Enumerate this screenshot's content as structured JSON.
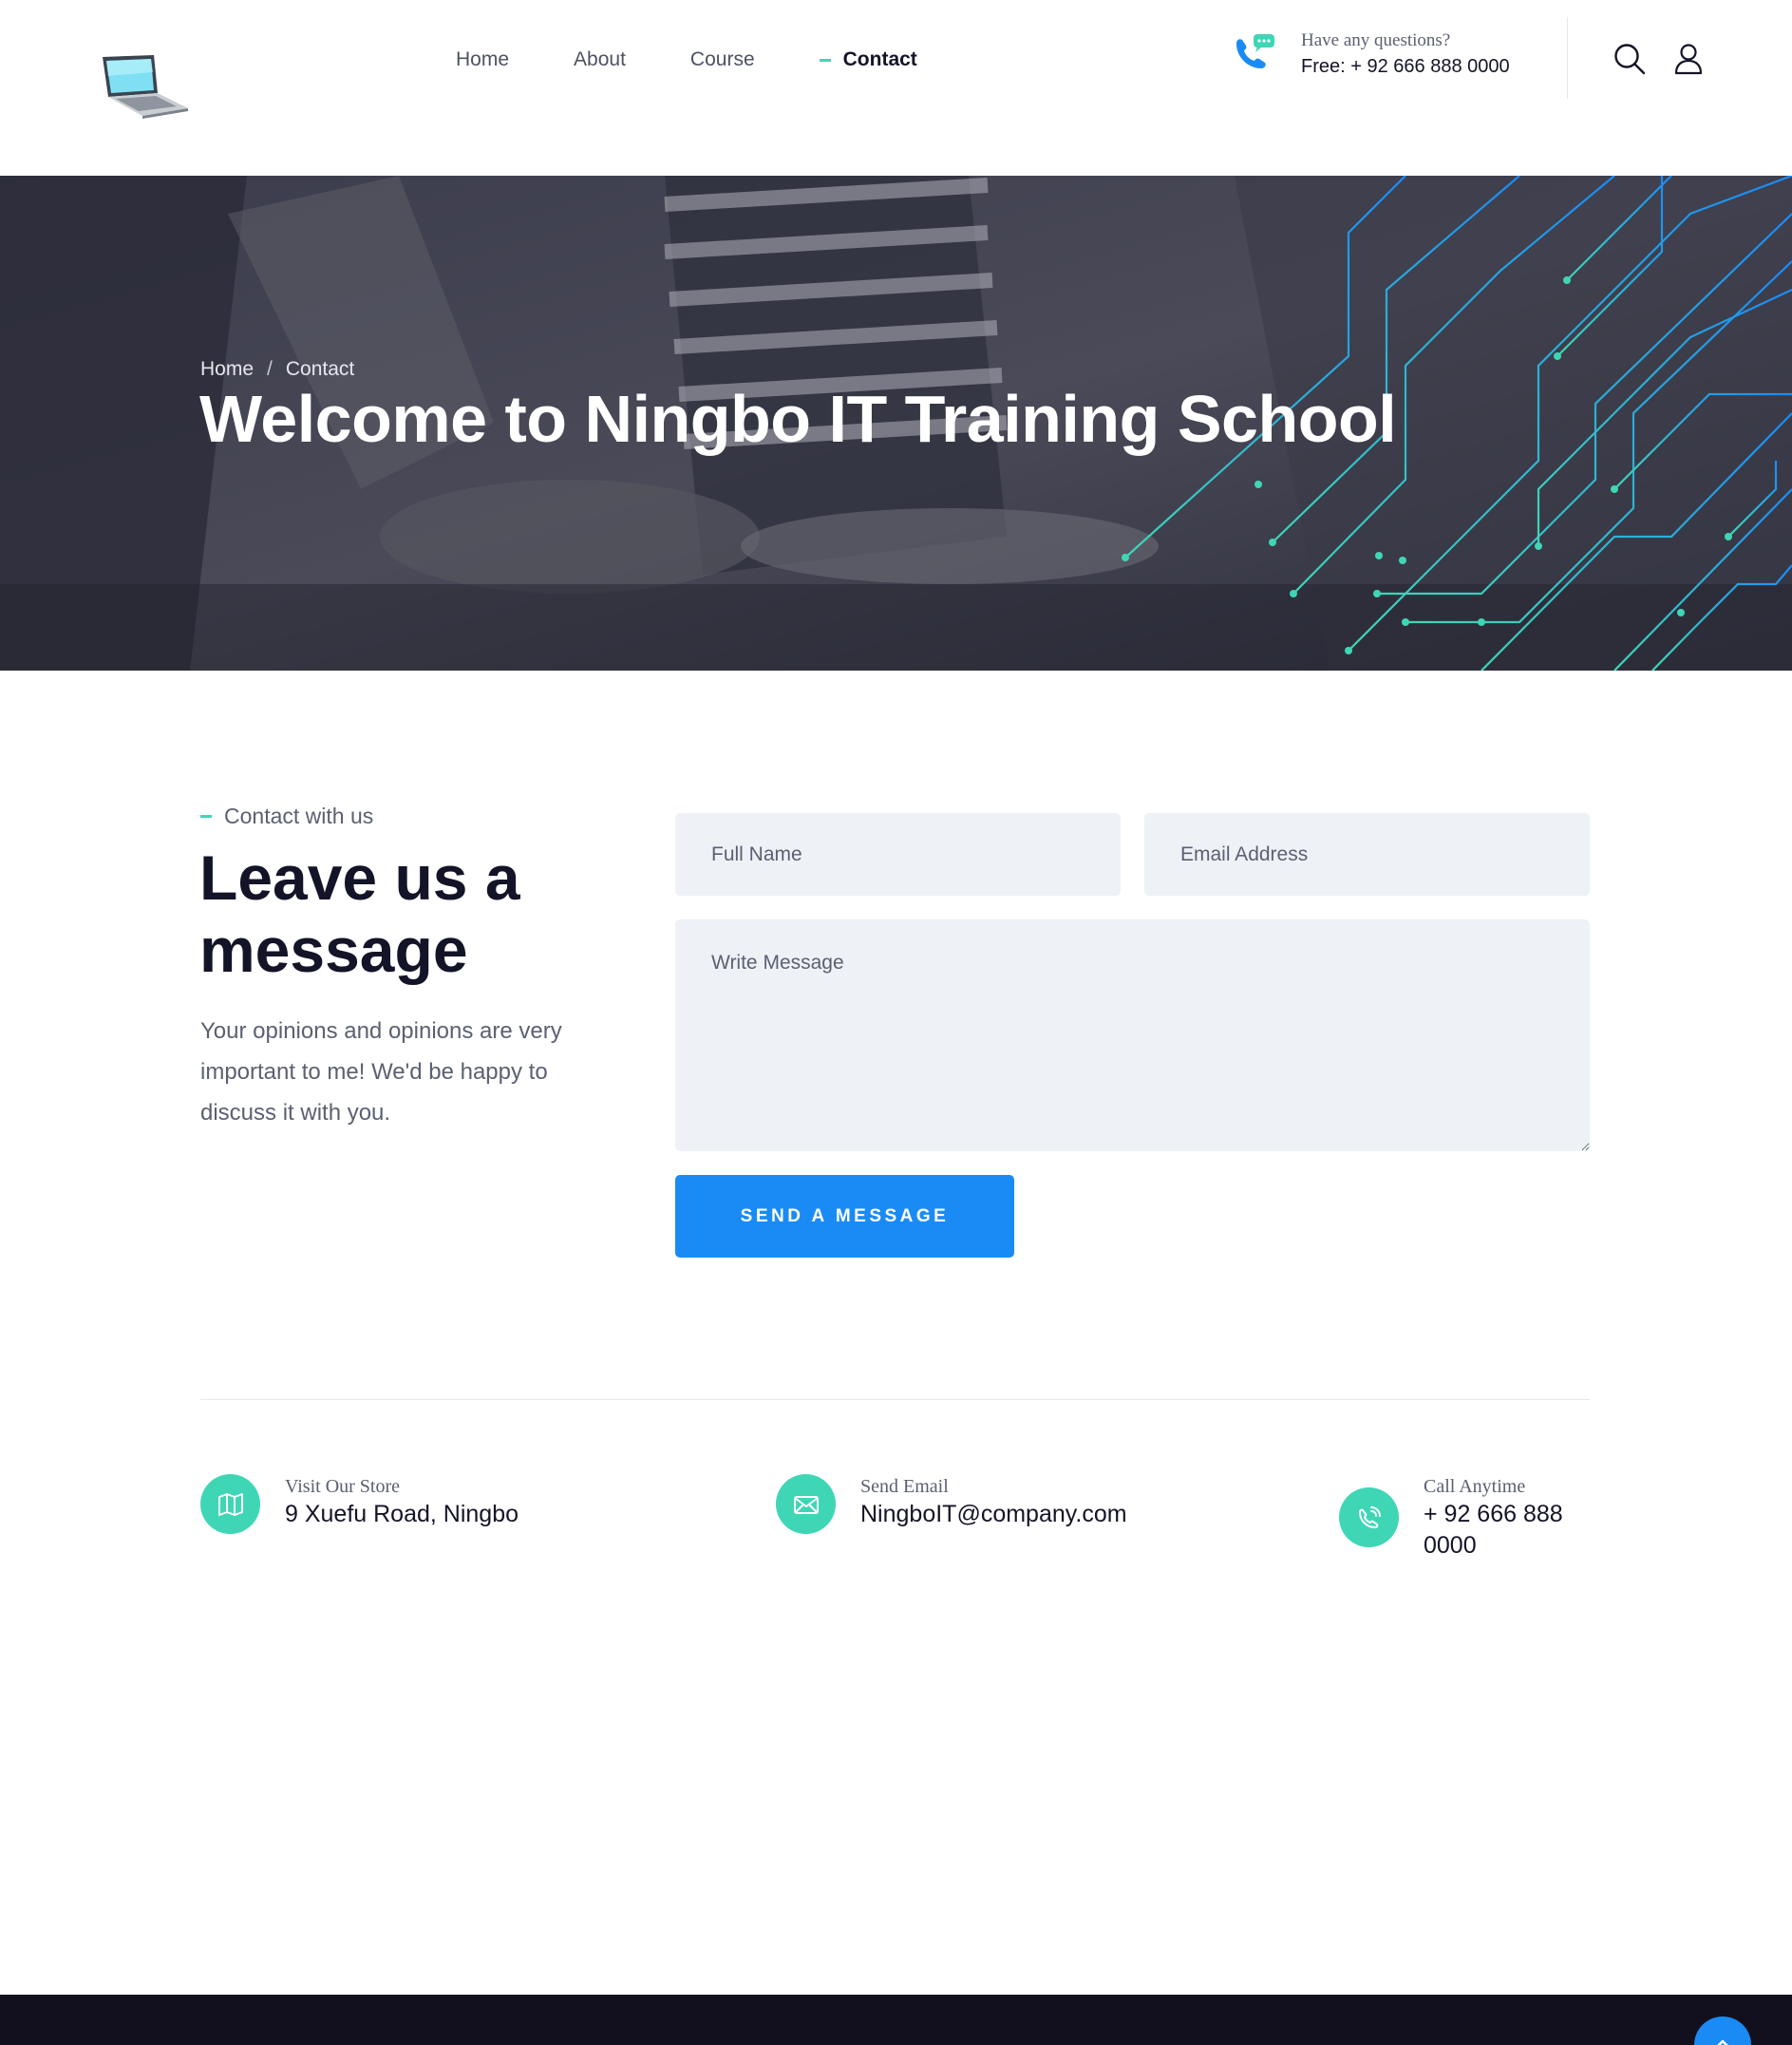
{
  "colors": {
    "accent_blue": "#1a8bf5",
    "accent_teal": "#3fd6b6",
    "heading_dark": "#141428",
    "text_muted": "#5b6072",
    "field_bg": "#eef2f6",
    "footer_bg": "#12101f"
  },
  "header": {
    "logo_icon": "laptop-icon",
    "nav": [
      {
        "label": "Home",
        "active": false
      },
      {
        "label": "About",
        "active": false
      },
      {
        "label": "Course",
        "active": false
      },
      {
        "label": "Contact",
        "active": true
      }
    ],
    "help": {
      "icon": "phone-chat-icon",
      "question": "Have any questions?",
      "phone": "Free: + 92 666 888 0000"
    },
    "search_icon": "search-icon",
    "user_icon": "user-icon"
  },
  "hero": {
    "breadcrumb": {
      "home": "Home",
      "separator": "/",
      "current": "Contact"
    },
    "title": "Welcome to Ningbo IT Training School"
  },
  "contact": {
    "tag": "Contact with us",
    "title": "Leave us a message",
    "description": "Your opinions and opinions are very important to me! We'd be happy to discuss it with you.",
    "form": {
      "name_placeholder": "Full Name",
      "email_placeholder": "Email Address",
      "message_placeholder": "Write Message",
      "submit_label": "SEND A MESSAGE"
    }
  },
  "info": [
    {
      "icon": "map-icon",
      "label": "Visit Our Store",
      "value": "9 Xuefu Road, Ningbo"
    },
    {
      "icon": "envelope-icon",
      "label": "Send Email",
      "value": "NingboIT@company.com"
    },
    {
      "icon": "phone-icon",
      "label": "Call Anytime",
      "value": "+ 92 666 888 0000"
    }
  ],
  "footer": {
    "scroll_top_icon": "arrow-up-icon"
  }
}
